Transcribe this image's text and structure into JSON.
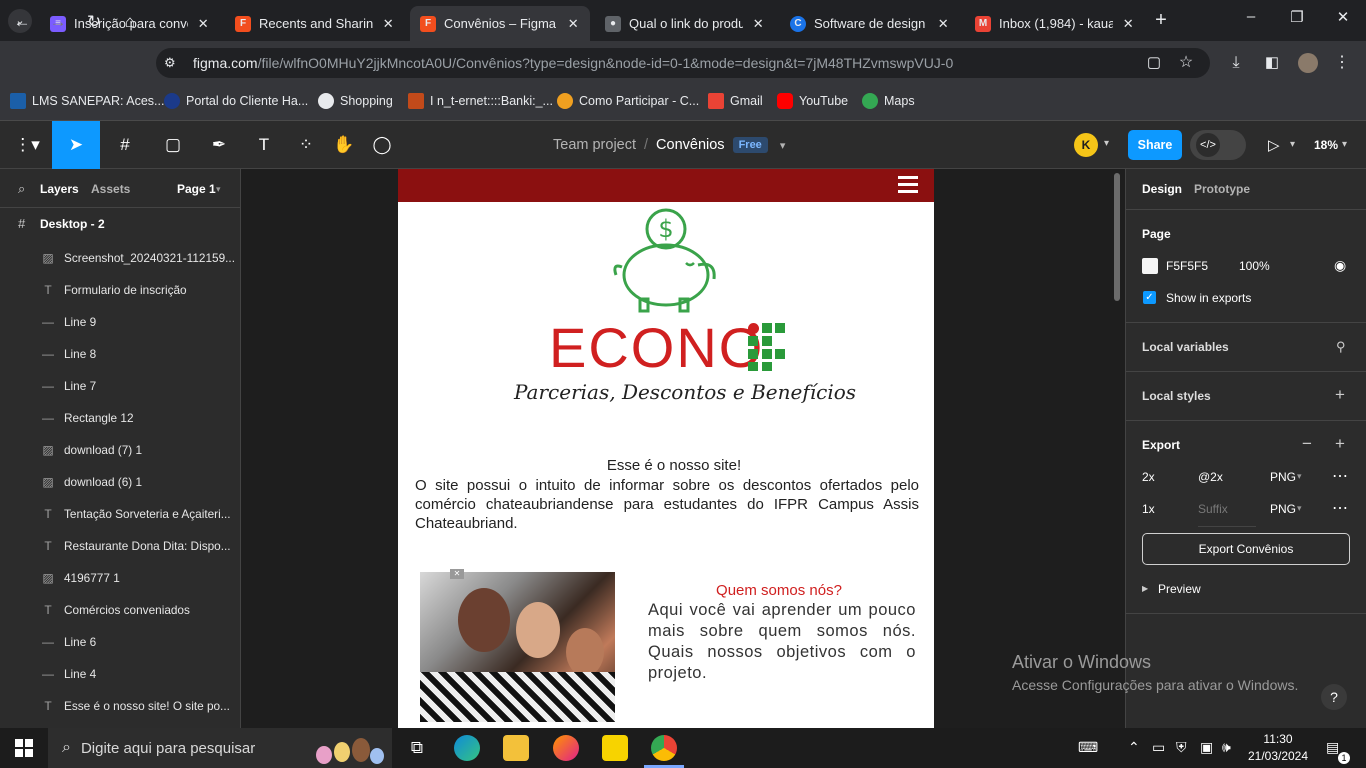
{
  "browser": {
    "tabs": [
      {
        "title": "Inscrição para convên",
        "color": "#7b5cff"
      },
      {
        "title": "Recents and Sharing -",
        "color": "#f24e1e"
      },
      {
        "title": "Convênios – Figma",
        "color": "#f24e1e"
      },
      {
        "title": "Qual o link do produt",
        "color": "#5f6368"
      },
      {
        "title": "Software de design g",
        "color": "#1a73e8"
      },
      {
        "title": "Inbox (1,984) - kauarc",
        "color": "#ea4335"
      }
    ],
    "url_host": "figma.com",
    "url_path": "/file/wlfnO0MHuY2jjkMncotA0U/Convênios?type=design&node-id=0-1&mode=design&t=7jM48THZvmswpVUJ-0",
    "bookmarks": [
      "LMS SANEPAR: Aces...",
      "Portal do Cliente Ha...",
      "Shopping",
      "I n_t-ernet::::Banki:_...",
      "Como Participar - C...",
      "Gmail",
      "YouTube",
      "Maps"
    ]
  },
  "figma": {
    "project": "Team project",
    "file": "Convênios",
    "plan_badge": "Free",
    "avatar_initial": "K",
    "share_label": "Share",
    "zoom": "18%",
    "left_tabs": {
      "layers": "Layers",
      "assets": "Assets",
      "page": "Page 1"
    },
    "frame_name": "Desktop - 2",
    "layers": [
      {
        "icon": "image",
        "name": "Screenshot_20240321-112159..."
      },
      {
        "icon": "text",
        "name": "Formulario de inscrição"
      },
      {
        "icon": "line",
        "name": "Line 9"
      },
      {
        "icon": "line",
        "name": "Line 8"
      },
      {
        "icon": "line",
        "name": "Line 7"
      },
      {
        "icon": "line",
        "name": "Rectangle 12"
      },
      {
        "icon": "image",
        "name": "download (7) 1"
      },
      {
        "icon": "image",
        "name": "download (6) 1"
      },
      {
        "icon": "text",
        "name": "Tentação Sorveteria e Açaiteri..."
      },
      {
        "icon": "text",
        "name": "Restaurante Dona Dita: Dispo..."
      },
      {
        "icon": "image",
        "name": "4196777 1"
      },
      {
        "icon": "text",
        "name": "Comércios conveniados"
      },
      {
        "icon": "line",
        "name": "Line 6"
      },
      {
        "icon": "line",
        "name": "Line 4"
      },
      {
        "icon": "text",
        "name": "Esse é o nosso site! O site po..."
      }
    ],
    "right": {
      "tab_design": "Design",
      "tab_prototype": "Prototype",
      "page_label": "Page",
      "page_color": "F5F5F5",
      "page_opacity": "100%",
      "show_in_exports": "Show in exports",
      "local_variables": "Local variables",
      "local_styles": "Local styles",
      "export_label": "Export",
      "export_rows": [
        {
          "scale": "2x",
          "suffix": "@2x",
          "format": "PNG"
        },
        {
          "scale": "1x",
          "suffix": "",
          "suffix_placeholder": "Suffix",
          "format": "PNG"
        }
      ],
      "export_button": "Export Convênios",
      "preview": "Preview"
    }
  },
  "design": {
    "brand_red": "#8b1010",
    "logo_text": "ECONO",
    "tagline": "Parcerias, Descontos e Benefícios",
    "intro_title": "Esse é o nosso site!",
    "intro_body": "O site possui o intuito de informar sobre os descontos ofertados pelo comércio chateaubriandense para estudantes do IFPR Campus Assis Chateaubriand.",
    "about_title": "Quem somos nós?",
    "about_body": "Aqui você vai aprender um pouco mais sobre quem somos nós. Quais nossos objetivos com o projeto."
  },
  "windows": {
    "watermark_title": "Ativar o Windows",
    "watermark_body": "Acesse Configurações para ativar o Windows.",
    "search_placeholder": "Digite aqui para pesquisar",
    "time": "11:30",
    "date": "21/03/2024",
    "notification_count": "1"
  }
}
